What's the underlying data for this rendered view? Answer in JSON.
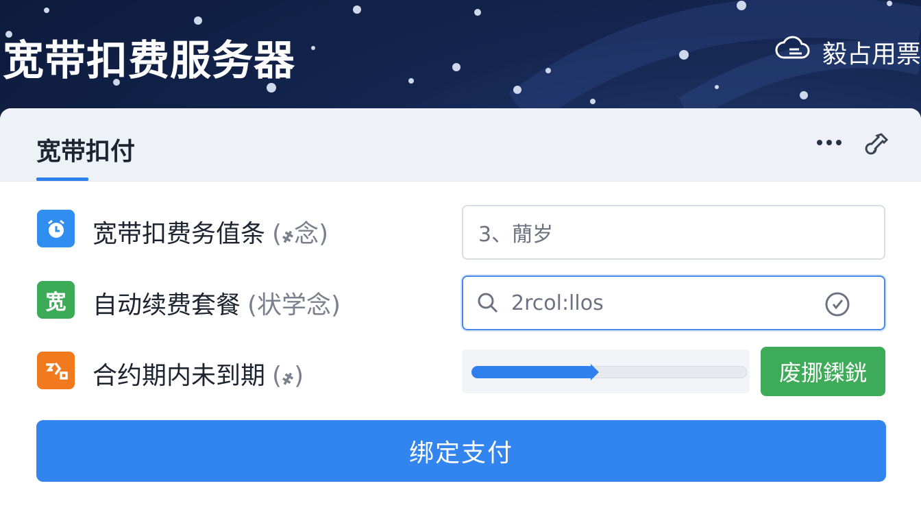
{
  "header": {
    "title": "宽带扣费服务器",
    "right_label": "毅占用票",
    "right_icon": "cloud-icon"
  },
  "card": {
    "tab_label": "宽带扣付",
    "more_icon": "more-icon",
    "settings_icon": "bottle-icon"
  },
  "rows": [
    {
      "label": "宽带扣费务值条",
      "hint": "(҂念)",
      "icon_text": "",
      "icon_name": "alarm-clock-icon",
      "icon_color": "#2f8ef0"
    },
    {
      "label": "自动续费套餐",
      "hint": "(状学念)",
      "icon_text": "宽",
      "icon_name": "broadband-icon",
      "icon_color": "#3cab57"
    },
    {
      "label": "合约期内未到期",
      "hint": "(҂)",
      "icon_text": "",
      "icon_name": "contract-icon",
      "icon_color": "#f07a1d"
    }
  ],
  "fields": {
    "first_value": "3、蕑岁",
    "search_value": "2rcol:llos"
  },
  "slider": {
    "progress": 0.45
  },
  "buttons": {
    "green": "废挪鏫銧",
    "bind": "绑定支付"
  },
  "colors": {
    "accent": "#2f80ed",
    "green": "#3dab57",
    "orange": "#f07a1d",
    "header_bg": "#0f1d3d"
  }
}
